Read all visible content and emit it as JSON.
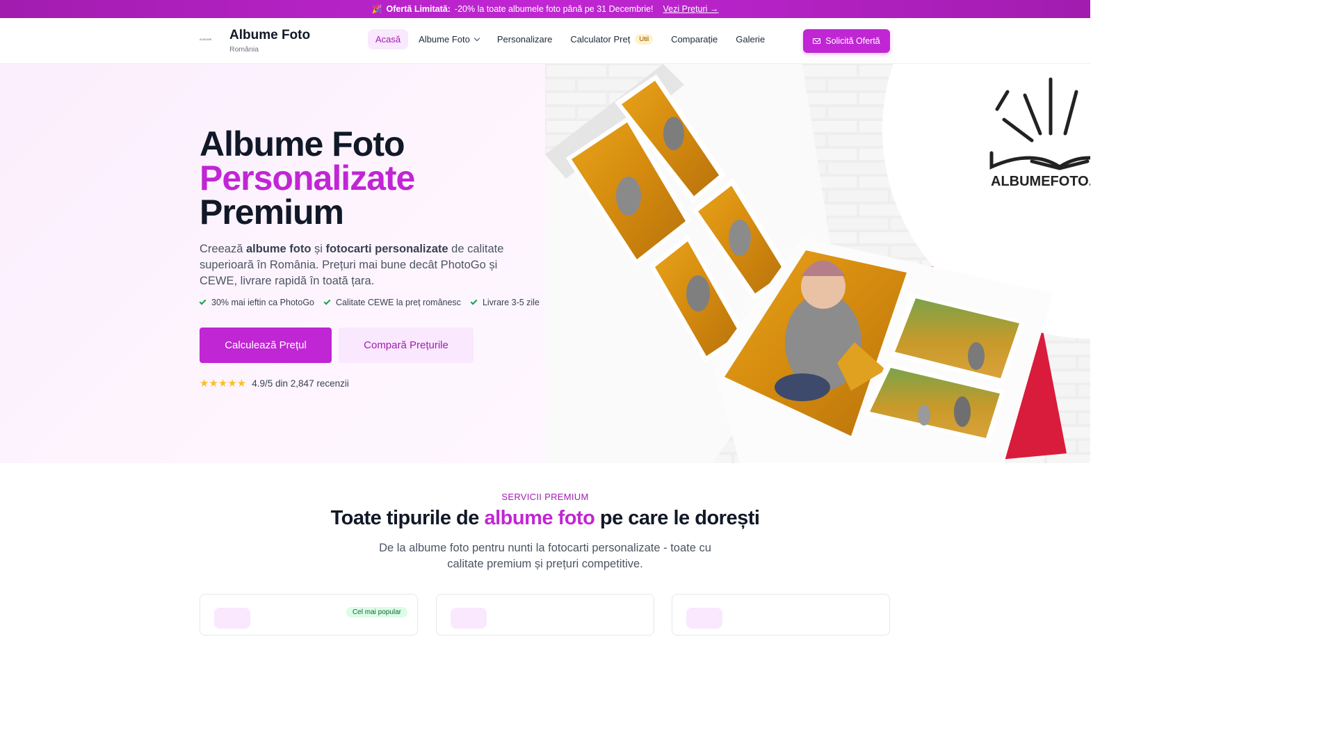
{
  "promo": {
    "emoji": "🎉",
    "label": "Ofertă Limitată:",
    "text": "-20% la toate albumele foto până pe 31 Decembrie!",
    "link": "Vezi Prețuri →"
  },
  "brand": {
    "logo_text": "ALBUME",
    "title": "Albume Foto",
    "subtitle": "România"
  },
  "nav": {
    "home": "Acasă",
    "albums": "Albume Foto",
    "personalize": "Personalizare",
    "calculator": "Calculator Preț",
    "calculator_badge": "Util",
    "compare": "Comparație",
    "gallery": "Galerie"
  },
  "header_cta": "Solicită Ofertă",
  "hero": {
    "title_line1": "Albume Foto",
    "title_line2": "Personalizate",
    "title_line3": "Premium",
    "desc_1": "Creează ",
    "desc_b1": "albume foto",
    "desc_2": " și ",
    "desc_b2": "fotocarti personalizate",
    "desc_3": " de calitate superioară în România. Prețuri mai bune decât PhotoGo și CEWE, livrare rapidă în toată țara.",
    "features": [
      "30% mai ieftin ca PhotoGo",
      "Calitate CEWE la preț românesc",
      "Livrare 3-5 zile"
    ],
    "primary_button": "Calculează Prețul",
    "secondary_button": "Compară Prețurile",
    "stars": "★★★★★",
    "rating_value": 4.9,
    "rating_text": "4.9/5 din 2,847 recenzii"
  },
  "hero_image": {
    "sign_text": "ALBUMEFOTO.C"
  },
  "services": {
    "kicker": "SERVICII PREMIUM",
    "title_1": "Toate tipurile de ",
    "title_accent": "albume foto",
    "title_2": " pe care le dorești",
    "desc": "De la albume foto pentru nunti la fotocarti personalizate - toate cu calitate premium și prețuri competitive.",
    "popular_badge": "Cel mai popular"
  },
  "colors": {
    "brand": "#c026d3",
    "brand_dark": "#a21caf",
    "brand_light": "#fae8ff",
    "star": "#fbbf24",
    "check": "#16a34a"
  },
  "icons": {
    "mail": "mail-icon",
    "check": "check-icon",
    "chevron": "chevron-down-icon",
    "star": "star-icon"
  }
}
